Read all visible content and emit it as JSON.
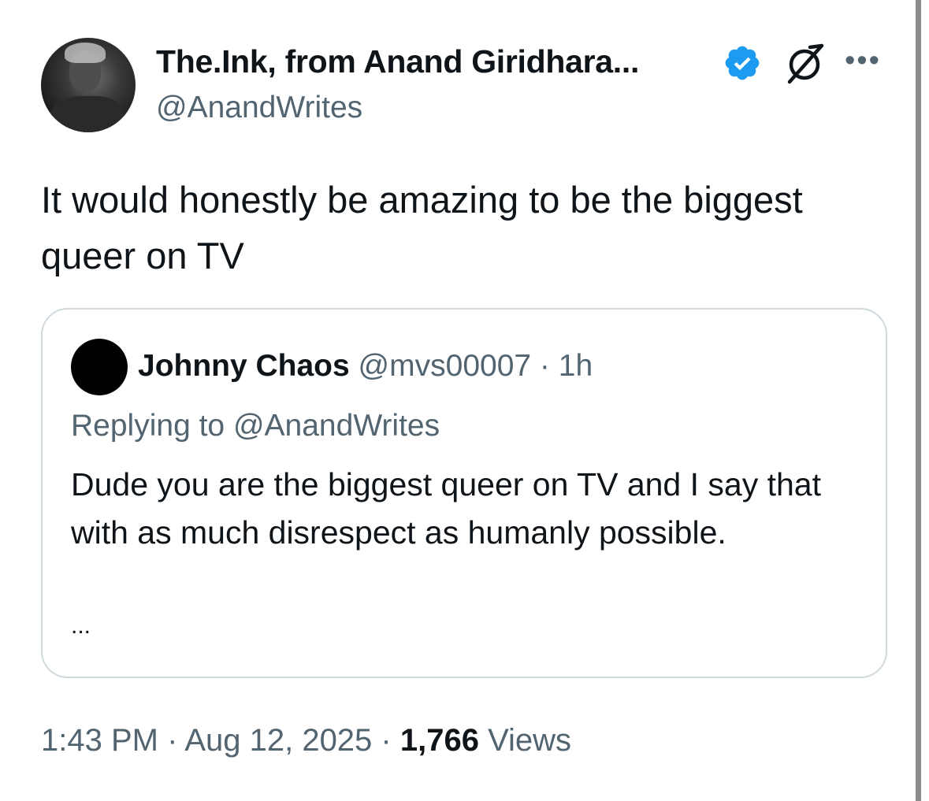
{
  "tweet": {
    "author": {
      "display_name": "The.Ink, from Anand Giridhara...",
      "handle": "@AnandWrites",
      "verified": true,
      "avatar_icon": "author-photo-avatar"
    },
    "text": "It would honestly be amazing to be the biggest queer on TV",
    "more_icon": "more-horizontal-icon",
    "affiliate_icon": "affiliate-badge-icon"
  },
  "quote": {
    "author_name": "Johnny Chaos",
    "handle": "@mvs00007",
    "separator": " · ",
    "time": "1h",
    "replying_to": "Replying to @AnandWrites",
    "text": "Dude you are the biggest queer on TV and I say that with as much disrespect as humanly possible.",
    "truncation": "..."
  },
  "meta": {
    "time": "1:43 PM",
    "date": "Aug 12, 2025",
    "separator": " · ",
    "views_count": "1,766",
    "views_label": " Views"
  },
  "colors": {
    "text_primary": "#0f1419",
    "text_secondary": "#536471",
    "verified_blue": "#1d9bf0",
    "card_border": "#cfd9de"
  }
}
